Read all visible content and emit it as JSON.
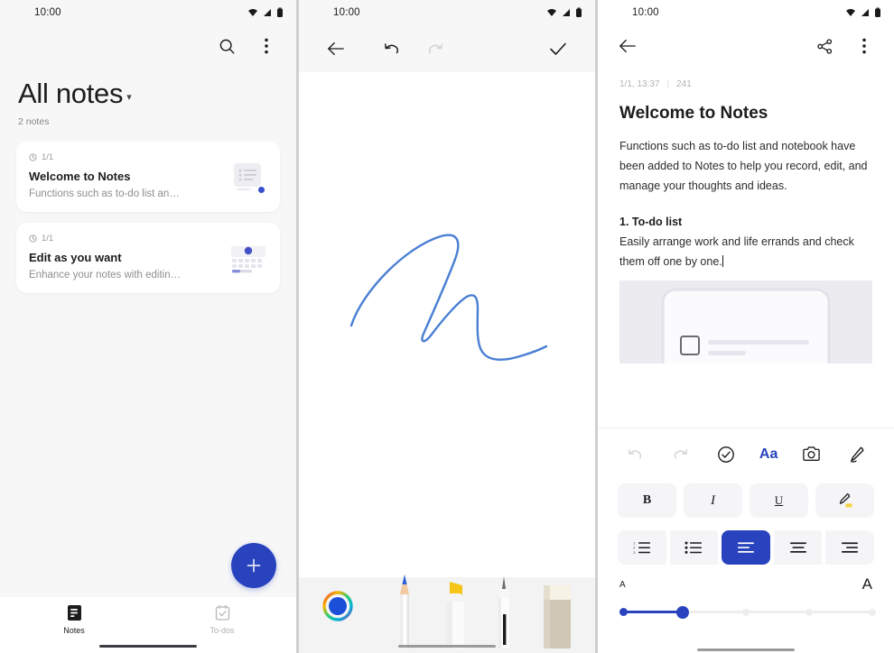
{
  "statusbar": {
    "time": "10:00",
    "icons": [
      "wifi-icon",
      "signal-icon",
      "battery-icon"
    ]
  },
  "colors": {
    "accent": "#2843bd",
    "accent_alt": "#3a4fd0",
    "ink_blue": "#4a7fd4",
    "highlight_yellow": "#f5c518",
    "panel_bg": "#f7f7f8"
  },
  "panel1": {
    "name": "notes-list",
    "search_label": "Search",
    "more_label": "More options",
    "title": "All notes",
    "title_caret": "▾",
    "count": "2 notes",
    "notes": [
      {
        "date": "1/1",
        "title": "Welcome to Notes",
        "snippet": "Functions such as to-do list an…",
        "thumb": "document-list-thumbnail"
      },
      {
        "date": "1/1",
        "title": "Edit as you want",
        "snippet": "Enhance your notes with editin…",
        "thumb": "keyboard-thumbnail"
      }
    ],
    "fab_label": "+",
    "nav": [
      {
        "label": "Notes",
        "icon": "notes-icon",
        "active": true
      },
      {
        "label": "To-dos",
        "icon": "todo-calendar-icon",
        "active": false
      }
    ]
  },
  "panel2": {
    "name": "handwriting-canvas",
    "toolbar": [
      {
        "label": "Back",
        "icon": "back-arrow-icon",
        "enabled": true
      },
      {
        "label": "Undo",
        "icon": "undo-icon",
        "enabled": true
      },
      {
        "label": "Redo",
        "icon": "redo-icon",
        "enabled": false
      },
      {
        "label": "Done",
        "icon": "check-icon",
        "enabled": true
      }
    ],
    "stroke_color": "#4a7fd4",
    "tools": [
      {
        "label": "Color",
        "icon": "color-wheel-icon",
        "selected_color": "#1b4fd8"
      },
      {
        "label": "Pencil",
        "icon": "pencil-tool-icon"
      },
      {
        "label": "Highlighter",
        "icon": "highlighter-tool-icon"
      },
      {
        "label": "Pen",
        "icon": "pen-tool-icon"
      },
      {
        "label": "Eraser",
        "icon": "eraser-tool-icon"
      }
    ]
  },
  "panel3": {
    "name": "note-editor",
    "toolbar": [
      {
        "label": "Back",
        "icon": "back-arrow-icon"
      },
      {
        "label": "Share",
        "icon": "share-icon"
      },
      {
        "label": "More options",
        "icon": "more-vertical-icon"
      }
    ],
    "meta_date": "1/1, 13:37",
    "meta_sep": "|",
    "meta_chars": "241",
    "title": "Welcome to Notes",
    "paragraph1": "Functions such as to-do list and notebook have been added to Notes to help you record, edit, and manage your thoughts and ideas.",
    "heading1": "1. To-do list",
    "paragraph2": "Easily arrange work and life errands and check them off one by one.",
    "embed_alt": "phone-mockup-checklist-image",
    "format_tools": [
      {
        "label": "Undo",
        "icon": "undo-icon",
        "enabled": false
      },
      {
        "label": "Redo",
        "icon": "redo-icon",
        "enabled": false
      },
      {
        "label": "Checklist",
        "icon": "check-circle-icon",
        "enabled": true
      },
      {
        "label": "Aa",
        "icon": "text-format-icon",
        "enabled": true,
        "active": true
      },
      {
        "label": "Camera",
        "icon": "camera-icon",
        "enabled": true
      },
      {
        "label": "Draw",
        "icon": "pen-icon",
        "enabled": true
      }
    ],
    "style_buttons": [
      {
        "label": "B",
        "name": "bold"
      },
      {
        "label": "I",
        "name": "italic"
      },
      {
        "label": "U",
        "name": "underline"
      },
      {
        "label": "",
        "name": "highlight"
      }
    ],
    "align_buttons": [
      {
        "name": "numbered-list",
        "selected": false
      },
      {
        "name": "bulleted-list",
        "selected": false
      },
      {
        "name": "align-left",
        "selected": true
      },
      {
        "name": "align-center",
        "selected": false
      },
      {
        "name": "align-right",
        "selected": false
      }
    ],
    "size_small": "A",
    "size_large": "A",
    "size_value": 1,
    "size_steps": 5
  }
}
